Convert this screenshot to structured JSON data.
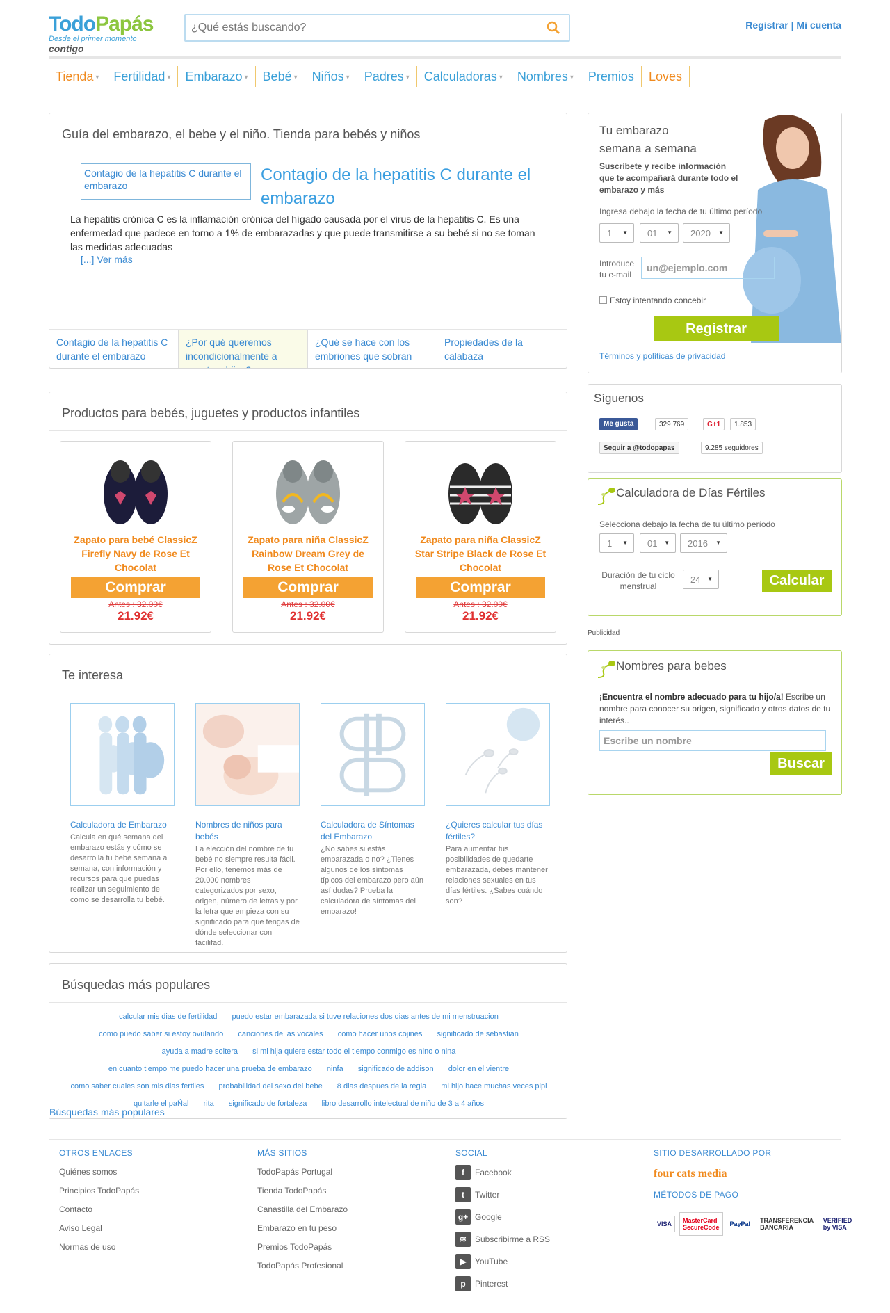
{
  "header": {
    "logo_main_a": "Todo",
    "logo_main_b": "Papás",
    "logo_tagline": "Desde el primer momento",
    "logo_contigo": "contigo",
    "search_placeholder": "¿Qué estás buscando?",
    "register": "Registrar",
    "separator": "|",
    "account": "Mi cuenta"
  },
  "nav": [
    {
      "label": "Tienda",
      "caret": true,
      "color": "#f08a1e"
    },
    {
      "label": "Fertilidad",
      "caret": true
    },
    {
      "label": "Embarazo",
      "caret": true
    },
    {
      "label": "Bebé",
      "caret": true
    },
    {
      "label": "Niños",
      "caret": true
    },
    {
      "label": "Padres",
      "caret": true
    },
    {
      "label": "Calculadoras",
      "caret": true
    },
    {
      "label": "Nombres",
      "caret": true
    },
    {
      "label": "Premios",
      "caret": false
    },
    {
      "label": "Loves",
      "caret": false,
      "color": "#f08a1e"
    }
  ],
  "featured": {
    "section_title": "Guía del embarazo, el bebe y el niño. Tienda para bebés y niños",
    "image_alt": "Contagio de la hepatitis C durante el embarazo",
    "title": "Contagio de la hepatitis C durante el embarazo",
    "text": "La hepatitis crónica C es la inflamación crónica del hígado causada por el virus de la hepatitis C. Es una enfermedad que padece en torno a 1% de embarazadas y que puede transmitirse a su bebé si no se toman las medidas adecuadas",
    "more": "[...] Ver más",
    "tabs": [
      "Contagio de la hepatitis C durante el embarazo",
      "¿Por qué queremos incondicionalmente a nuestros hijos?",
      "¿Qué se hace con los embriones que sobran",
      "Propiedades de la calabaza"
    ]
  },
  "products": {
    "section_title": "Productos para bebés, juguetes y productos infantiles",
    "buy_label": "Comprar",
    "items": [
      {
        "name": "Zapato para bebé ClassicZ Firefly Navy de Rose Et Chocolat",
        "old_price": "Antes : 32.00€",
        "price": "21.92€"
      },
      {
        "name": "Zapato para niña ClassicZ Rainbow Dream Grey de Rose Et Chocolat",
        "old_price": "Antes : 32.00€",
        "price": "21.92€"
      },
      {
        "name": "Zapato para niña ClassicZ Star Stripe Black de Rose Et Chocolat",
        "old_price": "Antes : 32.00€",
        "price": "21.92€"
      }
    ]
  },
  "interest": {
    "section_title": "Te interesa",
    "cards": [
      {
        "title": "Calculadora de Embarazo",
        "desc": "Calcula en qué semana del embarazo estás y cómo se desarrolla tu bebé semana a semana, con información y recursos para que puedas realizar un seguimiento de como se desarrolla tu bebé.",
        "icon": "pregnancy-silhouette-icon"
      },
      {
        "title": "Nombres de niños para bebés",
        "desc": "La elección del nombre de tu bebé no siempre resulta fácil. Por ello, tenemos más de 20.000 nombres categorizados por sexo, origen, número de letras y por la letra que empieza con su significado para que tengas de dónde seleccionar con facilifad.",
        "icon": "baby-photo-icon"
      },
      {
        "title": "Calculadora de Síntomas del Embarazo",
        "desc": "¿No sabes si estás embarazada o no? ¿Tienes algunos de los síntomas típicos del embarazo pero aún así dudas? Prueba la calculadora de síntomas del embarazo!",
        "icon": "pregnancy-test-icon"
      },
      {
        "title": "¿Quieres calcular tus días fértiles?",
        "desc": "Para aumentar tus posibilidades de quedarte embarazada, debes mantener relaciones sexuales en tus días fértiles. ¿Sabes cuándo son?",
        "icon": "sperm-egg-icon"
      }
    ]
  },
  "popular": {
    "section_title": "Búsquedas más populares",
    "tags": [
      "calcular mis dias de fertilidad",
      "puedo estar embarazada si tuve relaciones dos dias antes de mi menstruacion",
      "como puedo saber si estoy ovulando",
      "canciones de las vocales",
      "como hacer unos cojines",
      "significado de sebastian",
      "ayuda a madre soltera",
      "si mi hija quiere estar todo el tiempo conmigo es nino o nina",
      "en cuanto tiempo me puedo hacer una prueba de embarazo",
      "ninfa",
      "significado de addison",
      "dolor en el vientre",
      "como saber cuales son mis dias fertiles",
      "probabilidad del sexo del bebe",
      "8 dias despues de la regla",
      "mi hijo hace muchas veces pipi",
      "quitarle el paÑal",
      "rita",
      "significado de fortaleza",
      "libro desarrollo intelectual de niño de 3 a 4 años"
    ],
    "link": "Búsquedas más populares"
  },
  "pregnancy_widget": {
    "heading_line1": "Tu embarazo",
    "heading_line2": "semana a semana",
    "subtitle": "Suscríbete y recibe información que te acompañará durante todo el embarazo y más",
    "date_label": "Ingresa debajo la fecha de tu último período",
    "day": "1",
    "month": "01",
    "year": "2020",
    "email_label_1": "Introduce",
    "email_label_2": "tu e-mail",
    "email_placeholder": "un@ejemplo.com",
    "checkbox_label": "Estoy intentando concebir",
    "register_button": "Registrar",
    "terms_link": "Términos y políticas de privacidad"
  },
  "follow": {
    "title": "Síguenos",
    "like_label": "Me gusta",
    "like_count": "329 769",
    "gplus_label": "G+1",
    "gplus_count": "1.853",
    "twitter_label": "Seguir a @todopapas",
    "twitter_count": "9.285 seguidores"
  },
  "fertile_calc": {
    "title": "Calculadora de Días Fértiles",
    "date_label": "Selecciona debajo la fecha de tu último período",
    "day": "1",
    "month": "01",
    "year": "2016",
    "cycle_label": "Duración de tu ciclo menstrual",
    "cycle_value": "24",
    "button": "Calcular"
  },
  "ad_label": "Publicidad",
  "names_widget": {
    "title": "Nombres para bebes",
    "desc_bold": "¡Encuentra el nombre adecuado para tu hijo/a!",
    "desc_rest": " Escribe un nombre para conocer su origen, significado y otros datos de tu interés..",
    "placeholder": "Escribe un nombre",
    "button": "Buscar"
  },
  "footer": {
    "col1_title": "OTROS ENLACES",
    "col1_links": [
      "Quiénes somos",
      "Principios TodoPapás",
      "Contacto",
      "Aviso Legal",
      "Normas de uso"
    ],
    "col2_title": "MÁS SITIOS",
    "col2_links": [
      "TodoPapás Portugal",
      "Tienda TodoPapás",
      "Canastilla del Embarazo",
      "Embarazo en tu peso",
      "Premios TodoPapás",
      "TodoPapás Profesional"
    ],
    "col3_title": "SOCIAL",
    "col3_links": [
      {
        "label": "Facebook",
        "icon": "facebook-icon",
        "glyph": "f"
      },
      {
        "label": "Twitter",
        "icon": "twitter-icon",
        "glyph": "t"
      },
      {
        "label": "Google",
        "icon": "google-icon",
        "glyph": "g+"
      },
      {
        "label": "Subscribirme a RSS",
        "icon": "rss-icon",
        "glyph": "≋"
      },
      {
        "label": "YouTube",
        "icon": "youtube-icon",
        "glyph": "▶"
      },
      {
        "label": "Pinterest",
        "icon": "pinterest-icon",
        "glyph": "p"
      }
    ],
    "col4_title": "SITIO DESARROLLADO POR",
    "dev_logo": "four cats media",
    "payments_title": "MÉTODOS DE PAGO",
    "payments": [
      "VISA",
      "MasterCard SecureCode",
      "PayPal",
      "TRANSFERENCIA BANCARIA",
      "VERIFIED by VISA"
    ]
  },
  "colors": {
    "accent_blue": "#3aa0d8",
    "accent_orange": "#f08a1e",
    "accent_green": "#a8c812",
    "price_red": "#e03030"
  }
}
